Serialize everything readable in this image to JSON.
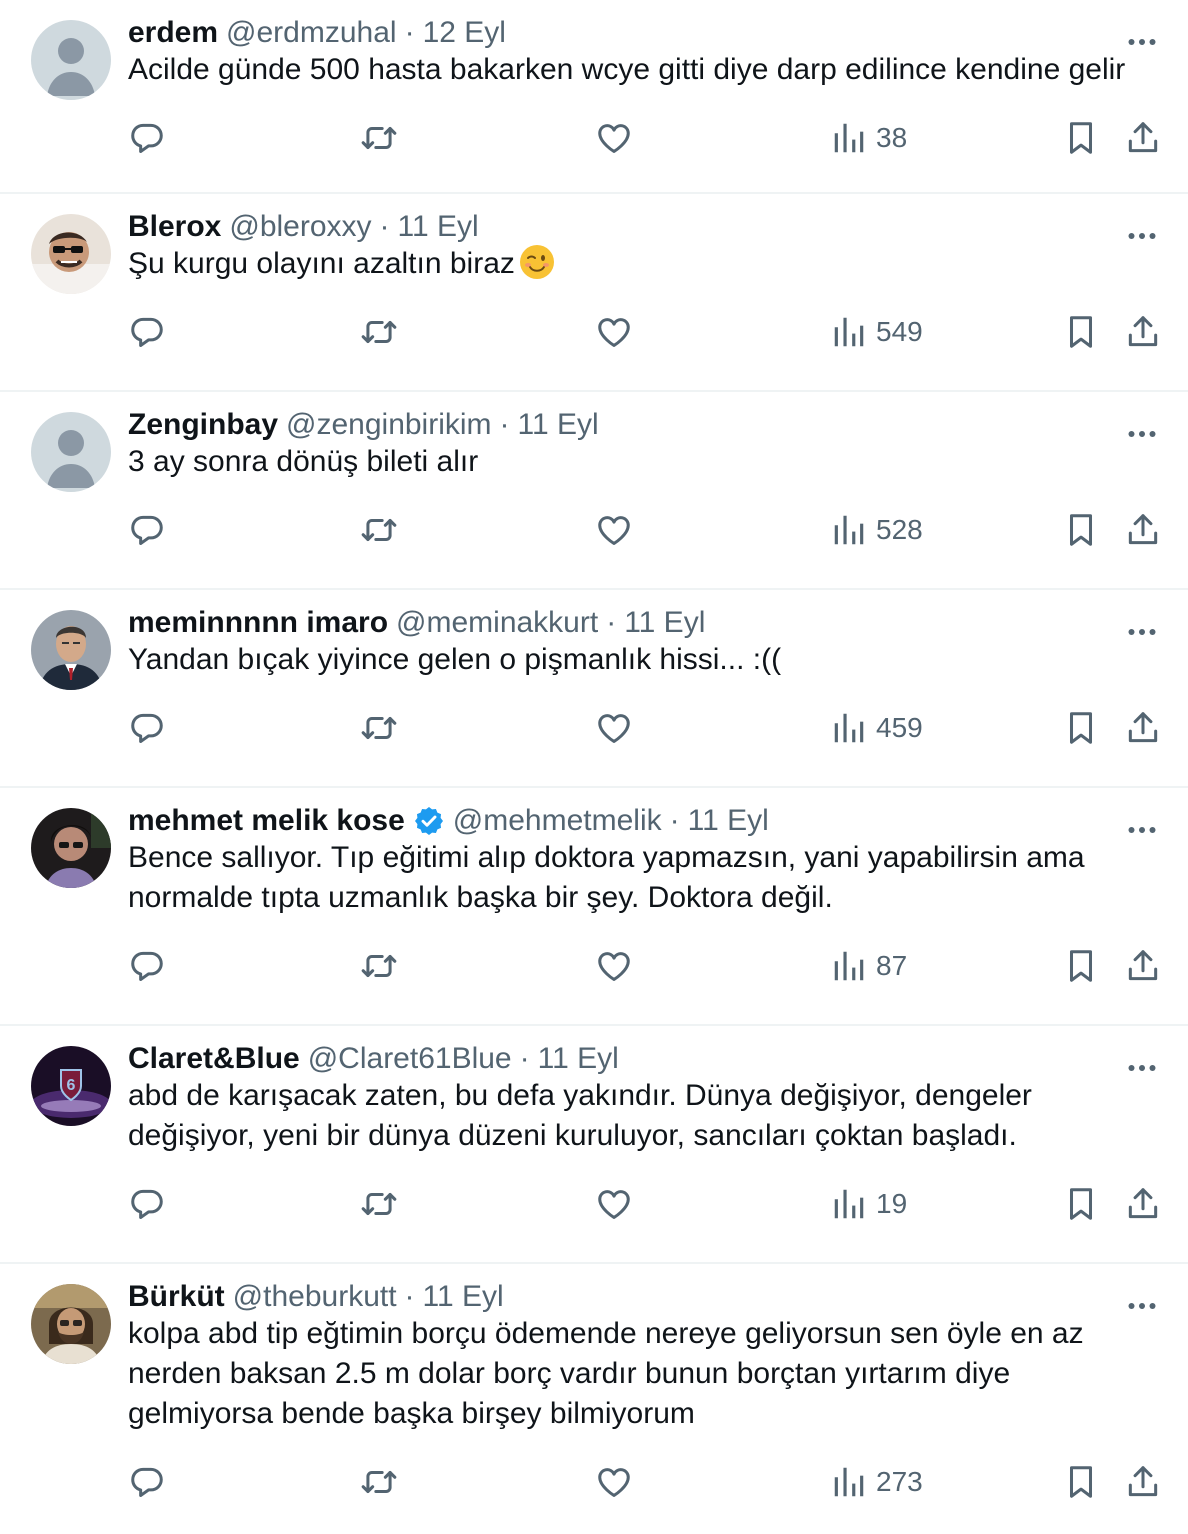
{
  "tweets": [
    {
      "name": "erdem",
      "handle": "@erdmzuhal",
      "dot": "·",
      "date": "12 Eyl",
      "lines": [
        "Acilde günde 500 hasta bakarken wcye gitti diye darp edilince kendine gelir"
      ],
      "views": "38",
      "avatar": "default-avatar",
      "verified": false
    },
    {
      "name": "Blerox",
      "handle": "@bleroxxy",
      "dot": "·",
      "date": "11 Eyl",
      "lines": [
        "Şu kurgu olayını azaltın biraz"
      ],
      "emoji": "winking-face-emoji",
      "views": "549",
      "avatar": "photo-avatar-sunglasses",
      "verified": false
    },
    {
      "name": "Zenginbay",
      "handle": "@zenginbirikim",
      "dot": "·",
      "date": "11 Eyl",
      "lines": [
        "3 ay sonra dönüş bileti alır"
      ],
      "views": "528",
      "avatar": "default-avatar",
      "verified": false
    },
    {
      "name": "meminnnnn imaro",
      "handle": "@meminakkurt",
      "dot": "·",
      "date": "11 Eyl",
      "lines": [
        "Yandan bıçak yiyince gelen o pişmanlık hissi... :(("
      ],
      "views": "459",
      "avatar": "photo-avatar-suit",
      "verified": false
    },
    {
      "name": "mehmet melik kose",
      "handle": "@mehmetmelik",
      "dot": "·",
      "date": "11 Eyl",
      "lines": [
        "Bence sallıyor. Tıp eğitimi alıp doktora yapmazsın,  yani yapabilirsin ama",
        "normalde tıpta uzmanlık başka bir şey. Doktora değil."
      ],
      "views": "87",
      "avatar": "photo-avatar-dark",
      "verified": true
    },
    {
      "name": "Claret&Blue",
      "handle": "@Claret61Blue",
      "dot": "·",
      "date": "11 Eyl",
      "lines": [
        "abd de karışacak zaten, bu defa yakındır. Dünya değişiyor, dengeler",
        "değişiyor, yeni bir dünya düzeni kuruluyor, sancıları çoktan başladı."
      ],
      "views": "19",
      "avatar": "club-logo-avatar",
      "verified": false
    },
    {
      "name": "Bürküt",
      "handle": "@theburkutt",
      "dot": "·",
      "date": "11 Eyl",
      "lines": [
        "kolpa abd tip eğtimin borçu ödemende nereye geliyorsun sen öyle en az",
        "nerden baksan 2.5 m dolar borç vardır bunun borçtan yırtarım diye",
        "gelmiyorsa bende başka birşey bilmiyorum"
      ],
      "views": "273",
      "avatar": "photo-avatar-beard",
      "verified": false
    }
  ],
  "icons": {
    "reply": "reply-icon",
    "retweet": "retweet-icon",
    "like": "like-icon",
    "views": "views-icon",
    "bookmark": "bookmark-icon",
    "share": "share-icon",
    "more": "more-icon"
  },
  "colors": {
    "text": "#0f1419",
    "secondary": "#536471",
    "divider": "#eff3f4",
    "verified": "#1d9bf0"
  }
}
